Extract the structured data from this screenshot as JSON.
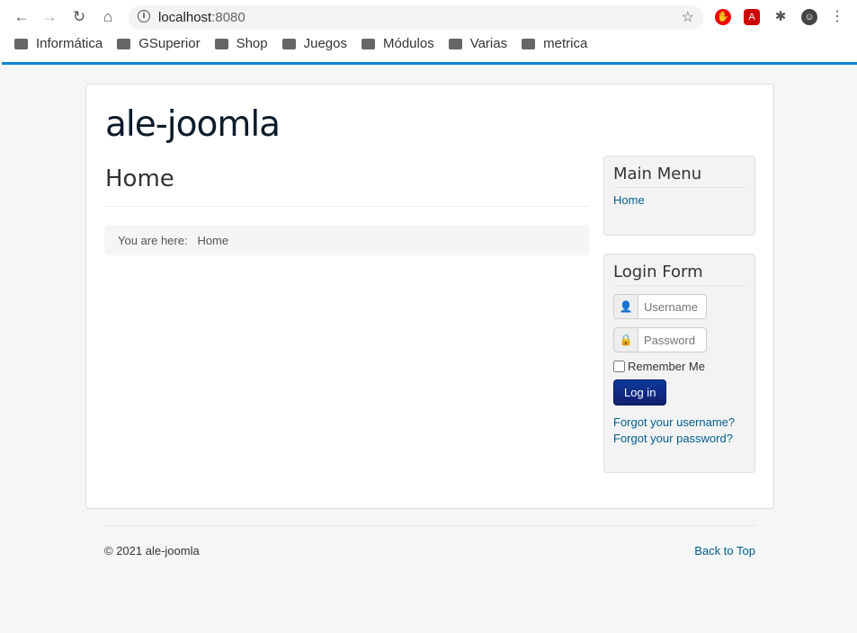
{
  "browser": {
    "url_host": "localhost",
    "url_port": ":8080",
    "bookmarks": [
      "Informática",
      "GSuperior",
      "Shop",
      "Juegos",
      "Módulos",
      "Varias",
      "metrica"
    ]
  },
  "site": {
    "brand": "ale-joomla",
    "page_title": "Home",
    "breadcrumb_label": "You are here:",
    "breadcrumb_current": "Home"
  },
  "main_menu": {
    "title": "Main Menu",
    "items": [
      "Home"
    ]
  },
  "login": {
    "title": "Login Form",
    "username_placeholder": "Username",
    "password_placeholder": "Password",
    "remember": "Remember Me",
    "submit": "Log in",
    "forgot_username": "Forgot your username?",
    "forgot_password": "Forgot your password?"
  },
  "footer": {
    "copyright": "© 2021 ale-joomla",
    "back_to_top": "Back to Top"
  }
}
